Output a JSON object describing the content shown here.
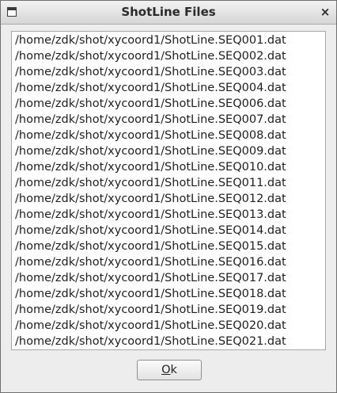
{
  "window": {
    "title": "ShotLine Files",
    "close_glyph": "×"
  },
  "file_list": {
    "items": [
      "/home/zdk/shot/xycoord1/ShotLine.SEQ001.dat",
      "/home/zdk/shot/xycoord1/ShotLine.SEQ002.dat",
      "/home/zdk/shot/xycoord1/ShotLine.SEQ003.dat",
      "/home/zdk/shot/xycoord1/ShotLine.SEQ004.dat",
      "/home/zdk/shot/xycoord1/ShotLine.SEQ006.dat",
      "/home/zdk/shot/xycoord1/ShotLine.SEQ007.dat",
      "/home/zdk/shot/xycoord1/ShotLine.SEQ008.dat",
      "/home/zdk/shot/xycoord1/ShotLine.SEQ009.dat",
      "/home/zdk/shot/xycoord1/ShotLine.SEQ010.dat",
      "/home/zdk/shot/xycoord1/ShotLine.SEQ011.dat",
      "/home/zdk/shot/xycoord1/ShotLine.SEQ012.dat",
      "/home/zdk/shot/xycoord1/ShotLine.SEQ013.dat",
      "/home/zdk/shot/xycoord1/ShotLine.SEQ014.dat",
      "/home/zdk/shot/xycoord1/ShotLine.SEQ015.dat",
      "/home/zdk/shot/xycoord1/ShotLine.SEQ016.dat",
      "/home/zdk/shot/xycoord1/ShotLine.SEQ017.dat",
      "/home/zdk/shot/xycoord1/ShotLine.SEQ018.dat",
      "/home/zdk/shot/xycoord1/ShotLine.SEQ019.dat",
      "/home/zdk/shot/xycoord1/ShotLine.SEQ020.dat",
      "/home/zdk/shot/xycoord1/ShotLine.SEQ021.dat"
    ]
  },
  "buttons": {
    "ok_mnemonic": "O",
    "ok_rest": "k"
  }
}
